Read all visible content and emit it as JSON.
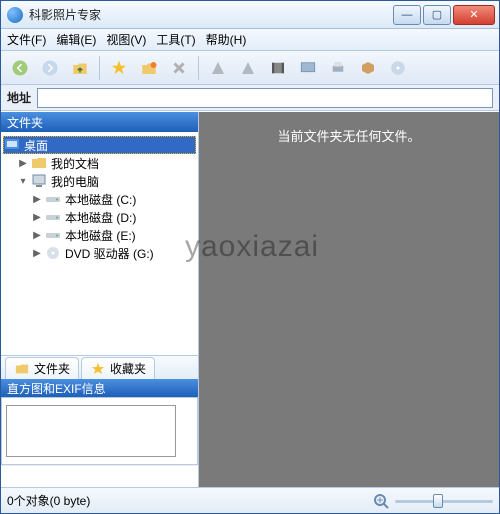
{
  "window": {
    "title": "科影照片专家"
  },
  "menu": {
    "file": "文件(F)",
    "edit": "编辑(E)",
    "view": "视图(V)",
    "tool": "工具(T)",
    "help": "帮助(H)"
  },
  "address": {
    "label": "地址"
  },
  "panes": {
    "folders": "文件夹",
    "info": "直方图和EXIF信息"
  },
  "tree": {
    "desktop": "桌面",
    "mydocs": "我的文档",
    "mycomputer": "我的电脑",
    "drives": {
      "c": "本地磁盘 (C:)",
      "d": "本地磁盘 (D:)",
      "e": "本地磁盘 (E:)",
      "g": "DVD 驱动器 (G:)"
    }
  },
  "tabs": {
    "folders": "文件夹",
    "favorites": "收藏夹"
  },
  "main": {
    "empty": "当前文件夹无任何文件。"
  },
  "status": {
    "objects": "0个对象(0 byte)"
  },
  "watermark": "yaoxiazai"
}
